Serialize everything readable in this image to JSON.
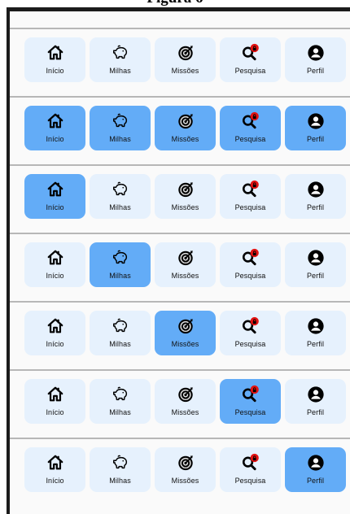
{
  "caption": "Figura 6",
  "tab_labels": [
    "Início",
    "Milhas",
    "Missões",
    "Pesquisa",
    "Perfil"
  ],
  "tab_icons": [
    "home-icon",
    "piggy-bank-icon",
    "target-icon",
    "search-locked-icon",
    "user-icon"
  ],
  "colors": {
    "tab_background": "#e6f1fd",
    "tab_active": "#63acf7",
    "badge_red": "#e31313",
    "divider": "#b7b7b7",
    "frame": "#1b1b1b"
  },
  "rows": [
    {
      "variant": "none-active",
      "active": []
    },
    {
      "variant": "all-active",
      "active": [
        0,
        1,
        2,
        3,
        4
      ]
    },
    {
      "variant": "inicio-active",
      "active": [
        0
      ]
    },
    {
      "variant": "milhas-active",
      "active": [
        1
      ]
    },
    {
      "variant": "missoes-active",
      "active": [
        2
      ]
    },
    {
      "variant": "pesquisa-active",
      "active": [
        3
      ]
    },
    {
      "variant": "perfil-active",
      "active": [
        4
      ]
    }
  ]
}
